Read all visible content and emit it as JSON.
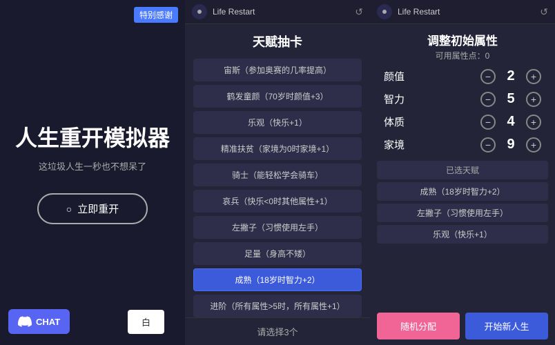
{
  "left": {
    "special_badge": "特别感谢",
    "main_title": "人生重开模拟器",
    "sub_title": "这垃圾人生一秒也不想呆了",
    "restart_label": "立即重开",
    "discord_label": "CHAT",
    "white_btn_label": "白"
  },
  "middle": {
    "window_title": "Life Restart",
    "panel_title": "天赋抽卡",
    "talents": [
      {
        "id": 1,
        "text": "宙斯（参加奥赛的几率提高）",
        "selected": false
      },
      {
        "id": 2,
        "text": "鹤发童颜（70岁时颜值+3）",
        "selected": false
      },
      {
        "id": 3,
        "text": "乐观（快乐+1）",
        "selected": false
      },
      {
        "id": 4,
        "text": "精准扶贫（家境为0时家境+1）",
        "selected": false
      },
      {
        "id": 5,
        "text": "骑士（能轻松学会骑车）",
        "selected": false
      },
      {
        "id": 6,
        "text": "哀兵（快乐<0时其他属性+1）",
        "selected": false
      },
      {
        "id": 7,
        "text": "左撇子（习惯使用左手）",
        "selected": false
      },
      {
        "id": 8,
        "text": "足量（身高不矮）",
        "selected": false
      },
      {
        "id": 9,
        "text": "成熟（18岁时智力+2）",
        "selected": true
      },
      {
        "id": 10,
        "text": "进阶（所有属性>5时，所有属性+1）",
        "selected": false
      }
    ],
    "footer": "请选择3个"
  },
  "right": {
    "window_title": "Life Restart",
    "attr_title": "调整初始属性",
    "attr_points_label": "可用属性点：0",
    "attributes": [
      {
        "name": "颜值",
        "value": 2
      },
      {
        "name": "智力",
        "value": 5
      },
      {
        "name": "体质",
        "value": 4
      },
      {
        "name": "家境",
        "value": 9
      }
    ],
    "selected_section_label": "已选天赋",
    "selected_talents": [
      "成熟（18岁时智力+2）",
      "左撇子（习惯使用左手）",
      "乐观（快乐+1）"
    ],
    "btn_random": "随机分配",
    "btn_start": "开始新人生"
  }
}
